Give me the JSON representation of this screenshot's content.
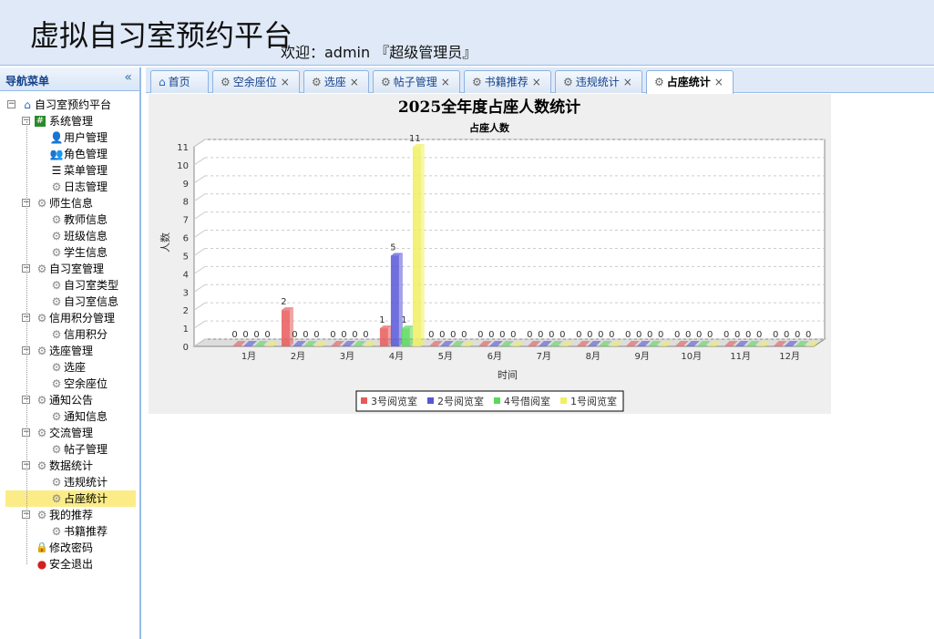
{
  "header": {
    "title": "虚拟自习室预约平台",
    "welcome": "欢迎：admin 『超级管理员』"
  },
  "sidebar": {
    "title": "导航菜单",
    "collapse_glyph": "«",
    "tree": [
      {
        "label": "自习室预约平台",
        "icon": "home-icon",
        "glyph": "⌂",
        "level": 0,
        "toggle": "−"
      },
      {
        "label": "系统管理",
        "icon": "grid-icon",
        "glyph": "#",
        "level": 1,
        "toggle": "−"
      },
      {
        "label": "用户管理",
        "icon": "user-icon",
        "glyph": "👤",
        "level": 2
      },
      {
        "label": "角色管理",
        "icon": "users-icon",
        "glyph": "👥",
        "level": 2
      },
      {
        "label": "菜单管理",
        "icon": "menu-icon",
        "glyph": "☰",
        "level": 2
      },
      {
        "label": "日志管理",
        "icon": "gear-icon",
        "glyph": "⚙",
        "level": 2
      },
      {
        "label": "师生信息",
        "icon": "gear-icon",
        "glyph": "⚙",
        "level": 1,
        "toggle": "−"
      },
      {
        "label": "教师信息",
        "icon": "gear-icon",
        "glyph": "⚙",
        "level": 2
      },
      {
        "label": "班级信息",
        "icon": "gear-icon",
        "glyph": "⚙",
        "level": 2
      },
      {
        "label": "学生信息",
        "icon": "gear-icon",
        "glyph": "⚙",
        "level": 2
      },
      {
        "label": "自习室管理",
        "icon": "gear-icon",
        "glyph": "⚙",
        "level": 1,
        "toggle": "−"
      },
      {
        "label": "自习室类型",
        "icon": "gear-icon",
        "glyph": "⚙",
        "level": 2
      },
      {
        "label": "自习室信息",
        "icon": "gear-icon",
        "glyph": "⚙",
        "level": 2
      },
      {
        "label": "信用积分管理",
        "icon": "gear-icon",
        "glyph": "⚙",
        "level": 1,
        "toggle": "−"
      },
      {
        "label": "信用积分",
        "icon": "gear-icon",
        "glyph": "⚙",
        "level": 2
      },
      {
        "label": "选座管理",
        "icon": "gear-icon",
        "glyph": "⚙",
        "level": 1,
        "toggle": "−"
      },
      {
        "label": "选座",
        "icon": "gear-icon",
        "glyph": "⚙",
        "level": 2
      },
      {
        "label": "空余座位",
        "icon": "gear-icon",
        "glyph": "⚙",
        "level": 2
      },
      {
        "label": "通知公告",
        "icon": "gear-icon",
        "glyph": "⚙",
        "level": 1,
        "toggle": "−"
      },
      {
        "label": "通知信息",
        "icon": "gear-icon",
        "glyph": "⚙",
        "level": 2
      },
      {
        "label": "交流管理",
        "icon": "gear-icon",
        "glyph": "⚙",
        "level": 1,
        "toggle": "−"
      },
      {
        "label": "帖子管理",
        "icon": "gear-icon",
        "glyph": "⚙",
        "level": 2
      },
      {
        "label": "数据统计",
        "icon": "gear-icon",
        "glyph": "⚙",
        "level": 1,
        "toggle": "−"
      },
      {
        "label": "违规统计",
        "icon": "gear-icon",
        "glyph": "⚙",
        "level": 2
      },
      {
        "label": "占座统计",
        "icon": "gear-icon",
        "glyph": "⚙",
        "level": 2,
        "selected": true
      },
      {
        "label": "我的推荐",
        "icon": "gear-icon",
        "glyph": "⚙",
        "level": 1,
        "toggle": "−"
      },
      {
        "label": "书籍推荐",
        "icon": "gear-icon",
        "glyph": "⚙",
        "level": 2
      },
      {
        "label": "修改密码",
        "icon": "lock-icon",
        "glyph": "🔒",
        "level": 1
      },
      {
        "label": "安全退出",
        "icon": "exit-icon",
        "glyph": "●",
        "level": 1
      }
    ]
  },
  "tabs": [
    {
      "label": "首页",
      "icon": "home-icon",
      "glyph": "⌂",
      "closable": false
    },
    {
      "label": "空余座位",
      "icon": "gear-icon",
      "glyph": "⚙",
      "closable": true
    },
    {
      "label": "选座",
      "icon": "gear-icon",
      "glyph": "⚙",
      "closable": true
    },
    {
      "label": "帖子管理",
      "icon": "gear-icon",
      "glyph": "⚙",
      "closable": true
    },
    {
      "label": "书籍推荐",
      "icon": "gear-icon",
      "glyph": "⚙",
      "closable": true
    },
    {
      "label": "违规统计",
      "icon": "gear-icon",
      "glyph": "⚙",
      "closable": true
    },
    {
      "label": "占座统计",
      "icon": "gear-icon",
      "glyph": "⚙",
      "closable": true,
      "active": true
    }
  ],
  "chart_data": {
    "type": "bar",
    "title": "2025全年度占座人数统计",
    "subtitle": "占座人数",
    "xlabel": "时间",
    "ylabel": "人数",
    "ylim": [
      0,
      11
    ],
    "grid": true,
    "legend_position": "bottom",
    "categories": [
      "1月",
      "2月",
      "3月",
      "4月",
      "5月",
      "6月",
      "7月",
      "8月",
      "9月",
      "10月",
      "11月",
      "12月"
    ],
    "series": [
      {
        "name": "3号阅览室",
        "color": "#e85a5a",
        "values": [
          0,
          2,
          0,
          1,
          0,
          0,
          0,
          0,
          0,
          0,
          0,
          0
        ]
      },
      {
        "name": "2号阅览室",
        "color": "#5656d8",
        "values": [
          0,
          0,
          0,
          5,
          0,
          0,
          0,
          0,
          0,
          0,
          0,
          0
        ]
      },
      {
        "name": "4号借阅室",
        "color": "#5ad85a",
        "values": [
          0,
          0,
          0,
          1,
          0,
          0,
          0,
          0,
          0,
          0,
          0,
          0
        ]
      },
      {
        "name": "1号阅览室",
        "color": "#f0f060",
        "values": [
          0,
          0,
          0,
          11,
          0,
          0,
          0,
          0,
          0,
          0,
          0,
          0
        ]
      }
    ]
  }
}
